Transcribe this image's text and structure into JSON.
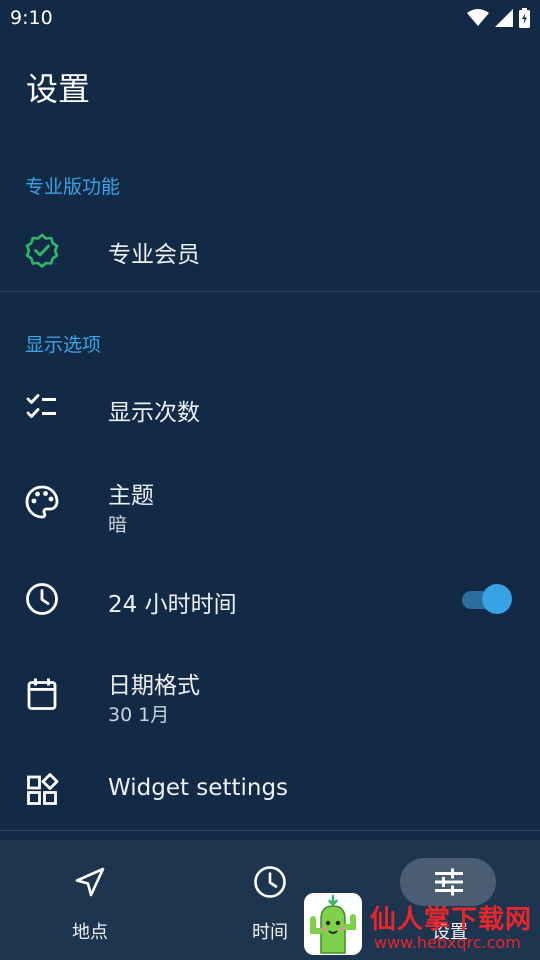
{
  "status_bar": {
    "time": "9:10",
    "icons": [
      "wifi-icon",
      "signal-icon",
      "battery-icon"
    ]
  },
  "page": {
    "title": "设置"
  },
  "sections": {
    "pro": {
      "header": "专业版功能",
      "items": [
        {
          "icon": "verified-badge-icon",
          "label": "专业会员",
          "icon_color": "#2fb86a"
        }
      ]
    },
    "display": {
      "header": "显示选项",
      "items": [
        {
          "icon": "checklist-icon",
          "label": "显示次数"
        },
        {
          "icon": "palette-icon",
          "label": "主题",
          "value": "暗"
        },
        {
          "icon": "clock-icon",
          "label": "24 小时时间",
          "toggle": true
        },
        {
          "icon": "calendar-icon",
          "label": "日期格式",
          "value": "30 1月"
        },
        {
          "icon": "widgets-icon",
          "label": "Widget settings"
        }
      ]
    }
  },
  "bottom_nav": {
    "items": [
      {
        "icon": "navigation-arrow-icon",
        "label": "地点",
        "active": false
      },
      {
        "icon": "clock-icon",
        "label": "时间",
        "active": false
      },
      {
        "icon": "sliders-icon",
        "label": "设置",
        "active": true
      }
    ]
  },
  "watermark": {
    "text": "仙人掌下载网",
    "url": "www.hebxqrc.com"
  },
  "colors": {
    "background": "#122a45",
    "accent": "#39a3e6",
    "nav_background": "#1e3550",
    "toggle_on": "#37a2e6"
  }
}
